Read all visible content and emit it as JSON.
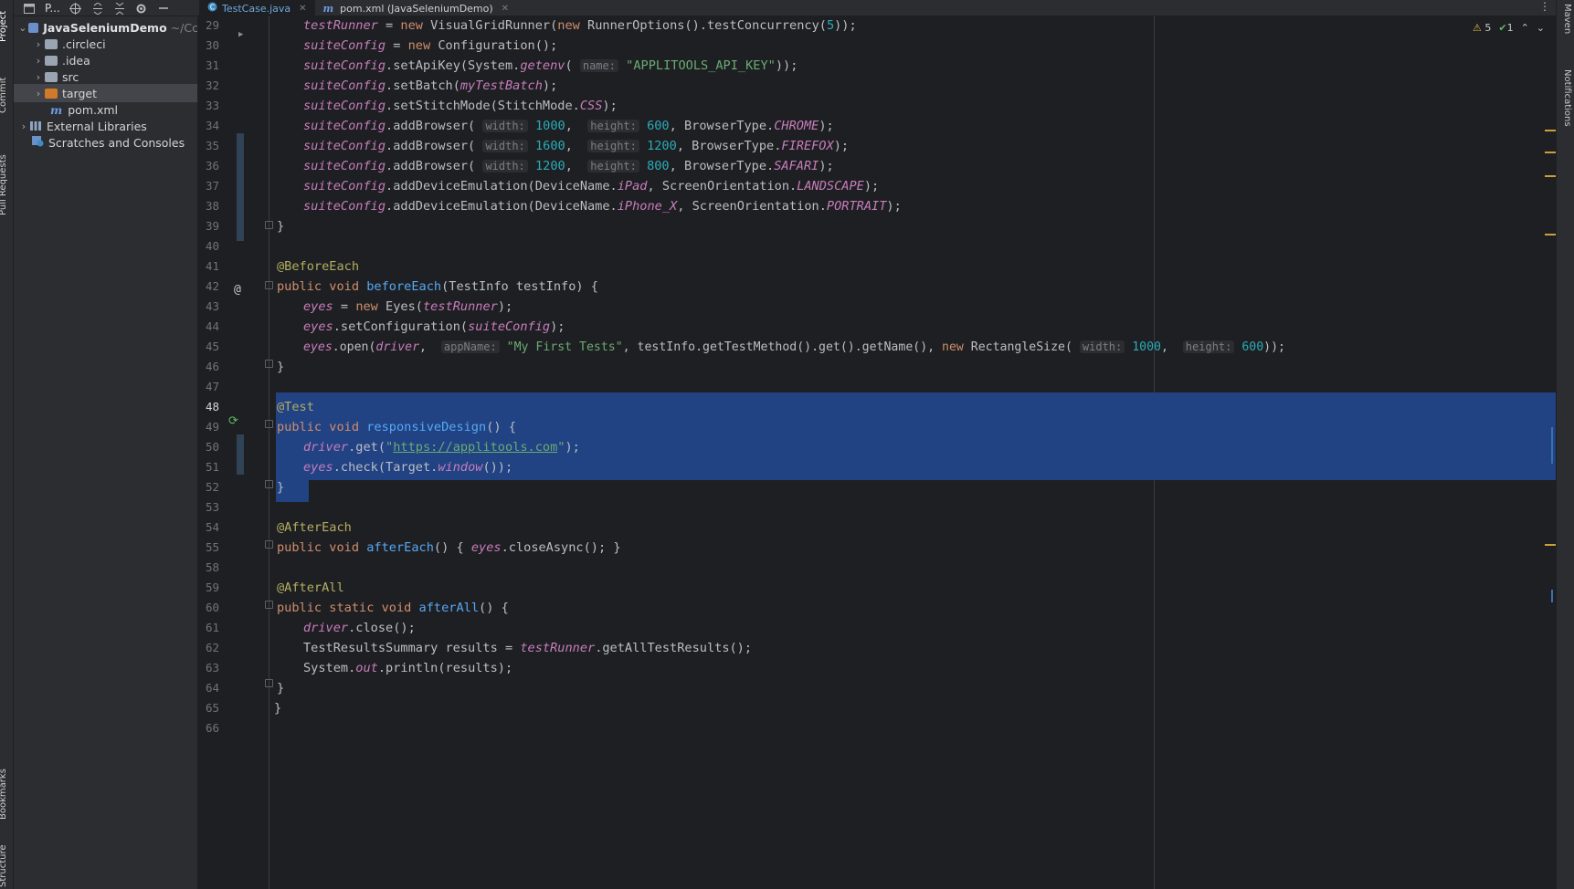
{
  "window": {
    "project_header_label": "P...",
    "project_header_icons": [
      "project-icon",
      "target-icon",
      "expand-all-icon",
      "collapse-all-icon",
      "gear-icon",
      "minimize-icon"
    ]
  },
  "tabs": [
    {
      "label": "TestCase.java",
      "icon": "java-class-icon",
      "active": true
    },
    {
      "label": "pom.xml (JavaSeleniumDemo)",
      "icon": "maven-icon",
      "active": false
    }
  ],
  "left_strip": {
    "project": "Project",
    "commit": "Commit",
    "pull_requests": "Pull Requests",
    "bookmarks": "Bookmarks",
    "structure": "Structure"
  },
  "right_strip": {
    "maven": "Maven",
    "notifications": "Notifications"
  },
  "tree": {
    "root_name": "JavaSeleniumDemo",
    "root_path": "~/Cc",
    "items": [
      {
        "label": ".circleci"
      },
      {
        "label": ".idea"
      },
      {
        "label": "src"
      },
      {
        "label": "target"
      },
      {
        "label": "pom.xml"
      },
      {
        "label": "External Libraries"
      },
      {
        "label": "Scratches and Consoles"
      }
    ]
  },
  "inspections": {
    "warnings": "5",
    "ok": "1"
  },
  "code": {
    "l29": {
      "n": "29",
      "t": "testRunner = new VisualGridRunner(new RunnerOptions().testConcurrency(5));"
    },
    "l30": {
      "n": "30",
      "t": "suiteConfig = new Configuration();"
    },
    "l31": {
      "n": "31",
      "t": "suiteConfig.setApiKey(System.getenv( name: \"APPLITOOLS_API_KEY\"));"
    },
    "l32": {
      "n": "32",
      "t": "suiteConfig.setBatch(myTestBatch);"
    },
    "l33": {
      "n": "33",
      "t": "suiteConfig.setStitchMode(StitchMode.CSS);"
    },
    "l34": {
      "n": "34",
      "t": "suiteConfig.addBrowser( width: 1000,  height: 600, BrowserType.CHROME);"
    },
    "l35": {
      "n": "35",
      "t": "suiteConfig.addBrowser( width: 1600,  height: 1200, BrowserType.FIREFOX);"
    },
    "l36": {
      "n": "36",
      "t": "suiteConfig.addBrowser( width: 1200,  height: 800, BrowserType.SAFARI);"
    },
    "l37": {
      "n": "37",
      "t": "suiteConfig.addDeviceEmulation(DeviceName.iPad, ScreenOrientation.LANDSCAPE);"
    },
    "l38": {
      "n": "38",
      "t": "suiteConfig.addDeviceEmulation(DeviceName.iPhone_X, ScreenOrientation.PORTRAIT);"
    },
    "l39": {
      "n": "39",
      "t": "}"
    },
    "l40": {
      "n": "40",
      "t": ""
    },
    "l41": {
      "n": "41",
      "t": "@BeforeEach"
    },
    "l42": {
      "n": "42",
      "t": "public void beforeEach(TestInfo testInfo) {"
    },
    "l43": {
      "n": "43",
      "t": "eyes = new Eyes(testRunner);"
    },
    "l44": {
      "n": "44",
      "t": "eyes.setConfiguration(suiteConfig);"
    },
    "l45": {
      "n": "45",
      "t": "eyes.open(driver,  appName: \"My First Tests\", testInfo.getTestMethod().get().getName(), new RectangleSize( width: 1000,  height: 600));"
    },
    "l46": {
      "n": "46",
      "t": "}"
    },
    "l47": {
      "n": "47",
      "t": ""
    },
    "l48": {
      "n": "48",
      "t": "@Test"
    },
    "l49": {
      "n": "49",
      "t": "public void responsiveDesign() {"
    },
    "l50": {
      "n": "50",
      "t": "driver.get(\"https://applitools.com\");"
    },
    "l51": {
      "n": "51",
      "t": "eyes.check(Target.window());"
    },
    "l52": {
      "n": "52",
      "t": "}"
    },
    "l53": {
      "n": "53",
      "t": ""
    },
    "l54": {
      "n": "54",
      "t": "@AfterEach"
    },
    "l55": {
      "n": "55",
      "t": "public void afterEach() { eyes.closeAsync(); }"
    },
    "l58": {
      "n": "58",
      "t": ""
    },
    "l59": {
      "n": "59",
      "t": "@AfterAll"
    },
    "l60": {
      "n": "60",
      "t": "public static void afterAll() {"
    },
    "l61": {
      "n": "61",
      "t": "driver.close();"
    },
    "l62": {
      "n": "62",
      "t": "TestResultsSummary results = testRunner.getAllTestResults();"
    },
    "l63": {
      "n": "63",
      "t": "System.out.println(results);"
    },
    "l64": {
      "n": "64",
      "t": "}"
    },
    "l65": {
      "n": "65",
      "t": "}"
    },
    "l66": {
      "n": "66",
      "t": ""
    }
  },
  "colors": {
    "editor_bg": "#1e1f22",
    "selection": "#214283",
    "keyword": "#cf8e6d",
    "field": "#c77dbb",
    "string": "#6aab73",
    "number": "#2aacb8",
    "annotation": "#b3ae60"
  }
}
